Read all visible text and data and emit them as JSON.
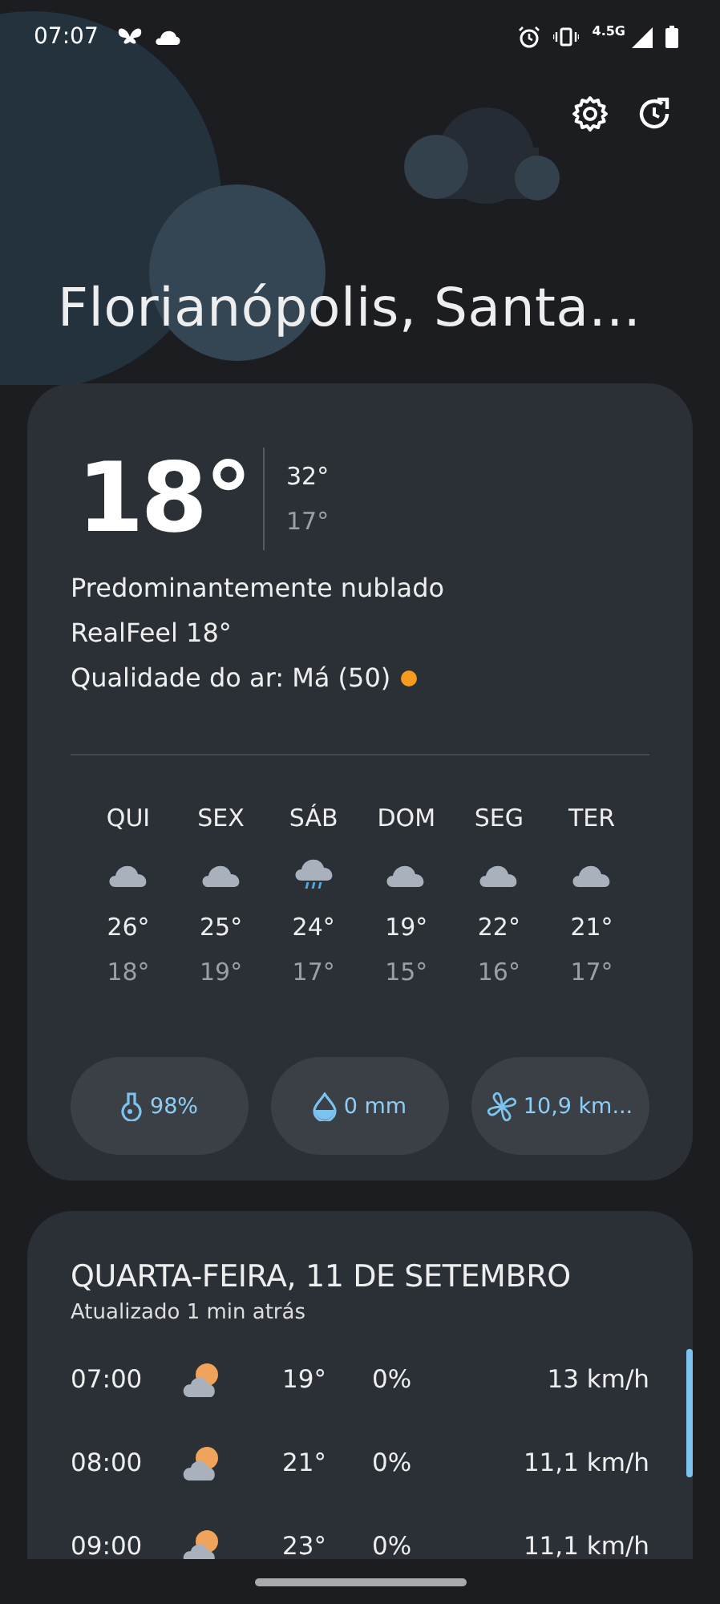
{
  "status_bar": {
    "time": "07:07",
    "network": "4.5G"
  },
  "header": {
    "location": "Florianópolis, Santa..."
  },
  "current": {
    "temperature": "18°",
    "high": "32°",
    "low": "17°",
    "condition": "Predominantemente nublado",
    "realfeel": "RealFeel 18°",
    "air_quality": {
      "text": "Qualidade do ar: Má (50)",
      "color": "#f39c1f"
    }
  },
  "forecast": [
    {
      "day": "QUI",
      "kind": "cloudy",
      "high": "26°",
      "low": "18°"
    },
    {
      "day": "SEX",
      "kind": "cloudy",
      "high": "25°",
      "low": "19°"
    },
    {
      "day": "SÁB",
      "kind": "rain",
      "high": "24°",
      "low": "17°"
    },
    {
      "day": "DOM",
      "kind": "cloudy",
      "high": "19°",
      "low": "15°"
    },
    {
      "day": "SEG",
      "kind": "cloudy",
      "high": "22°",
      "low": "16°"
    },
    {
      "day": "TER",
      "kind": "cloudy",
      "high": "21°",
      "low": "17°"
    }
  ],
  "stats": [
    {
      "kind": "humidity",
      "value": "98%"
    },
    {
      "kind": "precipitation",
      "value": "0 mm"
    },
    {
      "kind": "wind",
      "value": "10,9 km..."
    }
  ],
  "hourly": {
    "date": "QUARTA-FEIRA, 11 DE SETEMBRO",
    "updated": "Atualizado 1 min atrás",
    "rows": [
      {
        "time": "07:00",
        "kind": "partly-cloudy",
        "temp": "19°",
        "precip": "0%",
        "wind": "13 km/h"
      },
      {
        "time": "08:00",
        "kind": "partly-cloudy",
        "temp": "21°",
        "precip": "0%",
        "wind": "11,1 km/h"
      },
      {
        "time": "09:00",
        "kind": "partly-cloudy",
        "temp": "23°",
        "precip": "0%",
        "wind": "11,1 km/h"
      }
    ]
  }
}
